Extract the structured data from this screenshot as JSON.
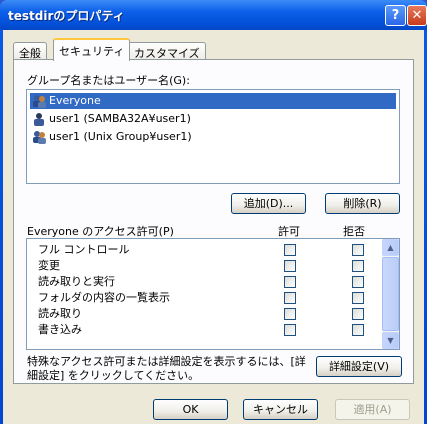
{
  "window": {
    "title": "testdirのプロパティ",
    "help_label": "?",
    "close_label": "✕"
  },
  "tabs": [
    {
      "label": "全般"
    },
    {
      "label": "セキュリティ"
    },
    {
      "label": "カスタマイズ"
    }
  ],
  "users": {
    "label": "グループ名またはユーザー名(G):",
    "items": [
      {
        "name": "Everyone",
        "icon": "group-icon",
        "selected": true
      },
      {
        "name": "user1 (SAMBA32A¥user1)",
        "icon": "user-icon",
        "selected": false
      },
      {
        "name": "user1 (Unix Group¥user1)",
        "icon": "group-icon",
        "selected": false
      }
    ],
    "add_button": "追加(D)...",
    "remove_button": "削除(R)"
  },
  "permissions": {
    "label": "Everyone のアクセス許可(P)",
    "allow_header": "許可",
    "deny_header": "拒否",
    "items": [
      {
        "name": "フル コントロール"
      },
      {
        "name": "変更"
      },
      {
        "name": "読み取りと実行"
      },
      {
        "name": "フォルダの内容の一覧表示"
      },
      {
        "name": "読み取り"
      },
      {
        "name": "書き込み"
      }
    ],
    "scroll_up": "▲",
    "scroll_down": "▼"
  },
  "advanced": {
    "text_line1": "特殊なアクセス許可または詳細設定を表示するには、[詳",
    "text_line2": "細設定] をクリックしてください。",
    "button": "詳細設定(V)"
  },
  "footer": {
    "ok": "OK",
    "cancel": "キャンセル",
    "apply": "適用(A)"
  },
  "colors": {
    "selection": "#316ac5",
    "titlebar": "#0350d8",
    "face": "#ece9d8"
  }
}
